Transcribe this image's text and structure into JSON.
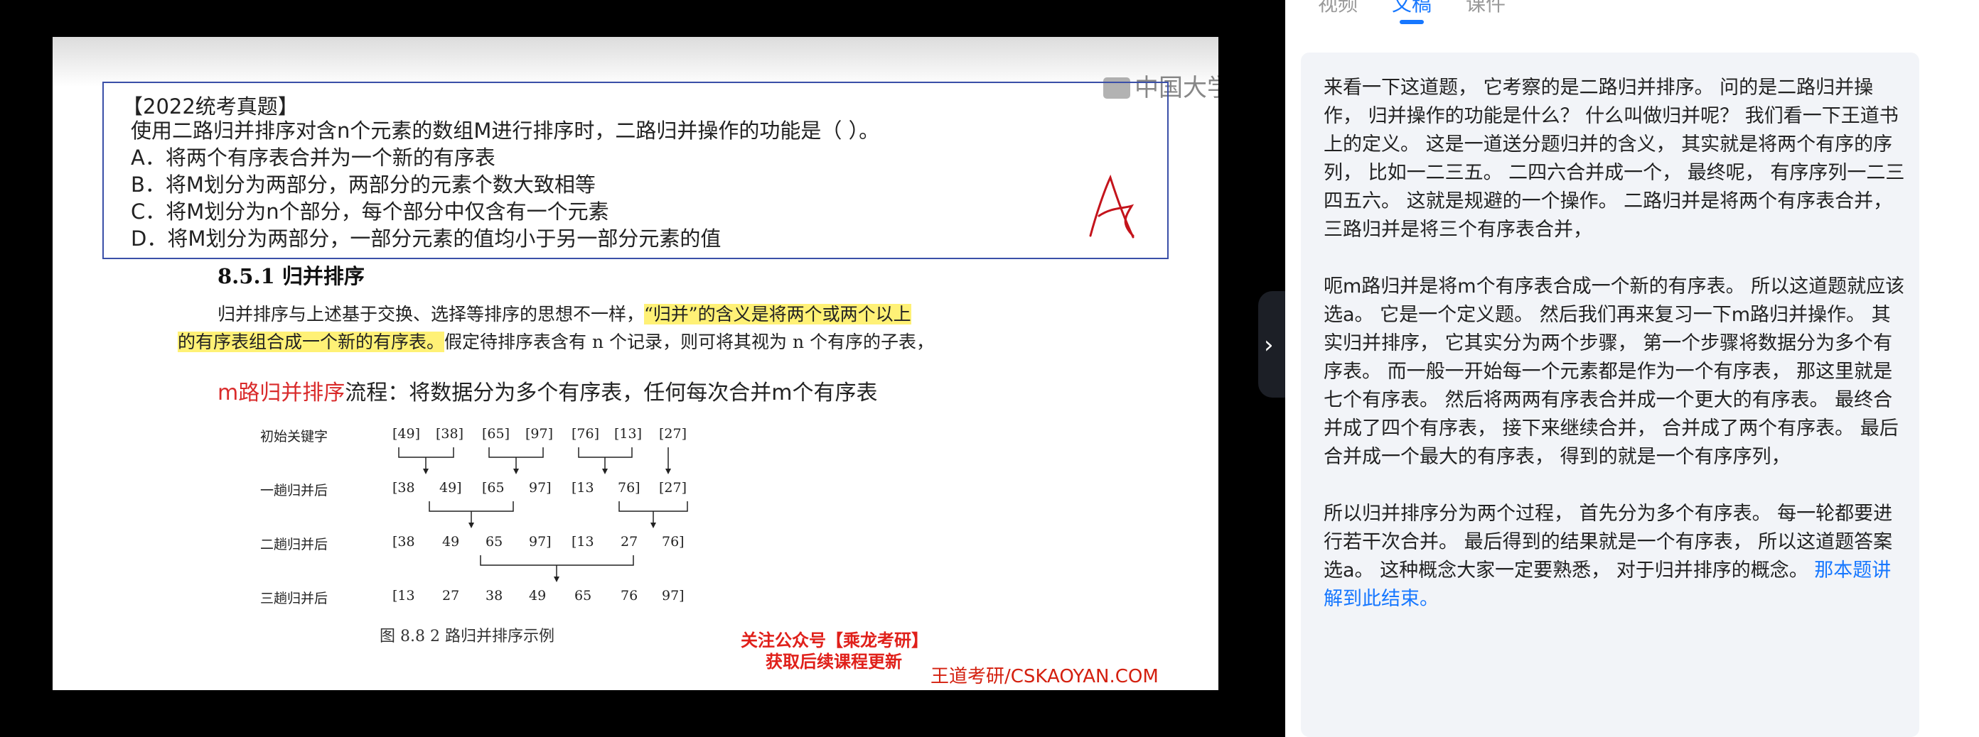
{
  "slide": {
    "watermark": "中国大学MOOC",
    "question": {
      "title": "【2022统考真题】",
      "stem": "使用二路归并排序对含n个元素的数组M进行排序时，二路归并操作的功能是（   ）。",
      "options": [
        "A．将两个有序表合并为一个新的有序表",
        "B．将M划分为两部分，两部分的元素个数大致相等",
        "C．将M划分为n个部分，每个部分中仅含有一个元素",
        "D．将M划分为两部分，一部分元素的值均小于另一部分元素的值"
      ],
      "handwritten_answer": "A"
    },
    "section_heading": "8.5.1    归并排序",
    "para_line1_prefix": "归并排序与上述基于交换、选择等排序的思想不一样，",
    "para_line1_highlight": "“归并”的含义是将两个或两个以上",
    "para_line2_highlight": "的有序表组合成一个新的有序表。",
    "para_line2_suffix": "假定待排序表含有 n 个记录，则可将其视为 n 个有序的子表，",
    "mroute_red": "m路归并排序",
    "mroute_text": "流程：将数据分为多个有序表，任何每次合并m个有序表",
    "diagram": {
      "row_labels": [
        "初始关键字",
        "一趟归并后",
        "二趟归并后",
        "三趟归并后"
      ],
      "rows": [
        [
          "[49]",
          "[38]",
          "[65]",
          "[97]",
          "[76]",
          "[13]",
          "[27]"
        ],
        [
          "[38",
          "49]",
          "[65",
          "97]",
          "[13",
          "76]",
          "[27]"
        ],
        [
          "[38",
          "49",
          "65",
          "97]",
          "[13",
          "27",
          "76]"
        ],
        [
          "[13",
          "27",
          "38",
          "49",
          "65",
          "76",
          "97]"
        ]
      ],
      "caption": "图 8.8    2 路归并排序示例"
    },
    "promo_line1": "关注公众号【乘龙考研】",
    "promo_line2": "获取后续课程更新",
    "brand": "王道考研/CSKAOYAN.COM"
  },
  "collapse_icon": "chevron-right-icon",
  "panel": {
    "tabs": [
      "视频",
      "文稿",
      "课件"
    ],
    "active_tab": "文稿",
    "transcript": {
      "p1": "来看一下这道题，  它考察的是二路归并排序。 问的是二路归并操作，  归并操作的功能是什么？ 什么叫做归并呢？ 我们看一下王道书上的定义。 这是一道送分题归并的含义，  其实就是将两个有序的序列，  比如一二三五。 二四六合并成一个，  最终呢，  有序序列一二三四五六。 这就是规避的一个操作。 二路归并是将两个有序表合并，  三路归并是将三个有序表合并，",
      "p2": "呃m路归并是将m个有序表合成一个新的有序表。 所以这道题就应该选a。 它是一个定义题。 然后我们再来复习一下m路归并操作。 其实归并排序，  它其实分为两个步骤，  第一个步骤将数据分为多个有序表。 而一般一开始每一个元素都是作为一个有序表，  那这里就是七个有序表。 然后将两两有序表合并成一个更大的有序表。 最终合并成了四个有序表，  接下来继续合并，  合并成了两个有序表。 最后合并成一个最大的有序表，  得到的就是一个有序序列，",
      "p3_text": "所以归并排序分为两个过程，  首先分为多个有序表。 每一轮都要进行若干次合并。 最后得到的结果就是一个有序表，  所以这道题答案选a。 这种概念大家一定要熟悉，  对于归并排序的概念。 ",
      "p3_link": "那本题讲解到此结束。"
    }
  },
  "colors": {
    "accent": "#1677ff",
    "highlight": "#fff176",
    "promo_red": "#e0201a",
    "box_border": "#3a4fa8"
  }
}
